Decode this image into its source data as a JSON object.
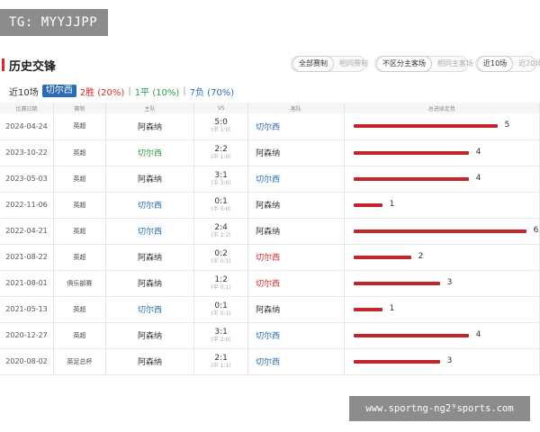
{
  "badge": {
    "text": "TG: MYYJJPP"
  },
  "section": {
    "title": "历史交锋",
    "toggles": [
      {
        "on_label": "全部赛制",
        "off_label": "相同赛制"
      },
      {
        "on_label": "不区分主客场",
        "off_label": "相同主客场"
      },
      {
        "on_label": "近10场",
        "off_label": "近20场"
      }
    ]
  },
  "filters": {
    "last_label": "近10场",
    "team": "切尔西",
    "win": "2胜 (20%)",
    "draw": "1平 (10%)",
    "loss": "7负 (70%)",
    "separator": "|"
  },
  "table": {
    "headers": [
      "比赛日期",
      "赛制",
      "主队",
      "VS",
      "客队",
      "总进球走势"
    ],
    "max_goals": 6,
    "colors": {
      "bar": "#c0272d",
      "chelsea_blue": "#2a6bb3",
      "chelsea_green": "#2c9a4a",
      "chelsea_red": "#d6262c"
    },
    "rows": [
      {
        "date": "2024-04-24",
        "comp": "英超",
        "home": "阿森纳",
        "home_cls": "team-default",
        "score": "5:0",
        "half": "(半 1:0)",
        "away": "切尔西",
        "away_cls": "team-chelsea",
        "goals": 5
      },
      {
        "date": "2023-10-22",
        "comp": "英超",
        "home": "切尔西",
        "home_cls": "team-chelsea-win",
        "score": "2:2",
        "half": "(半 1:0)",
        "away": "阿森纳",
        "away_cls": "team-default",
        "goals": 4
      },
      {
        "date": "2023-05-03",
        "comp": "英超",
        "home": "阿森纳",
        "home_cls": "team-default",
        "score": "3:1",
        "half": "(半 3:0)",
        "away": "切尔西",
        "away_cls": "team-chelsea",
        "goals": 4
      },
      {
        "date": "2022-11-06",
        "comp": "英超",
        "home": "切尔西",
        "home_cls": "team-chelsea",
        "score": "0:1",
        "half": "(半 0:0)",
        "away": "阿森纳",
        "away_cls": "team-default",
        "goals": 1
      },
      {
        "date": "2022-04-21",
        "comp": "英超",
        "home": "切尔西",
        "home_cls": "team-chelsea",
        "score": "2:4",
        "half": "(半 2:2)",
        "away": "阿森纳",
        "away_cls": "team-default",
        "goals": 6
      },
      {
        "date": "2021-08-22",
        "comp": "英超",
        "home": "阿森纳",
        "home_cls": "team-default",
        "score": "0:2",
        "half": "(半 0:1)",
        "away": "切尔西",
        "away_cls": "team-chelsea-loss",
        "goals": 2
      },
      {
        "date": "2021-08-01",
        "comp": "俱乐部赛",
        "home": "阿森纳",
        "home_cls": "team-default",
        "score": "1:2",
        "half": "(半 0:1)",
        "away": "切尔西",
        "away_cls": "team-chelsea-loss",
        "goals": 3
      },
      {
        "date": "2021-05-13",
        "comp": "英超",
        "home": "切尔西",
        "home_cls": "team-chelsea",
        "score": "0:1",
        "half": "(半 0:1)",
        "away": "阿森纳",
        "away_cls": "team-default",
        "goals": 1
      },
      {
        "date": "2020-12-27",
        "comp": "英超",
        "home": "阿森纳",
        "home_cls": "team-default",
        "score": "3:1",
        "half": "(半 2:0)",
        "away": "切尔西",
        "away_cls": "team-chelsea",
        "goals": 4
      },
      {
        "date": "2020-08-02",
        "comp": "英足总杯",
        "home": "阿森纳",
        "home_cls": "team-default",
        "score": "2:1",
        "half": "(半 1:1)",
        "away": "切尔西",
        "away_cls": "team-chelsea",
        "goals": 3
      }
    ]
  },
  "watermark": {
    "text": "www.sportng-ng2⁹sports.com"
  }
}
